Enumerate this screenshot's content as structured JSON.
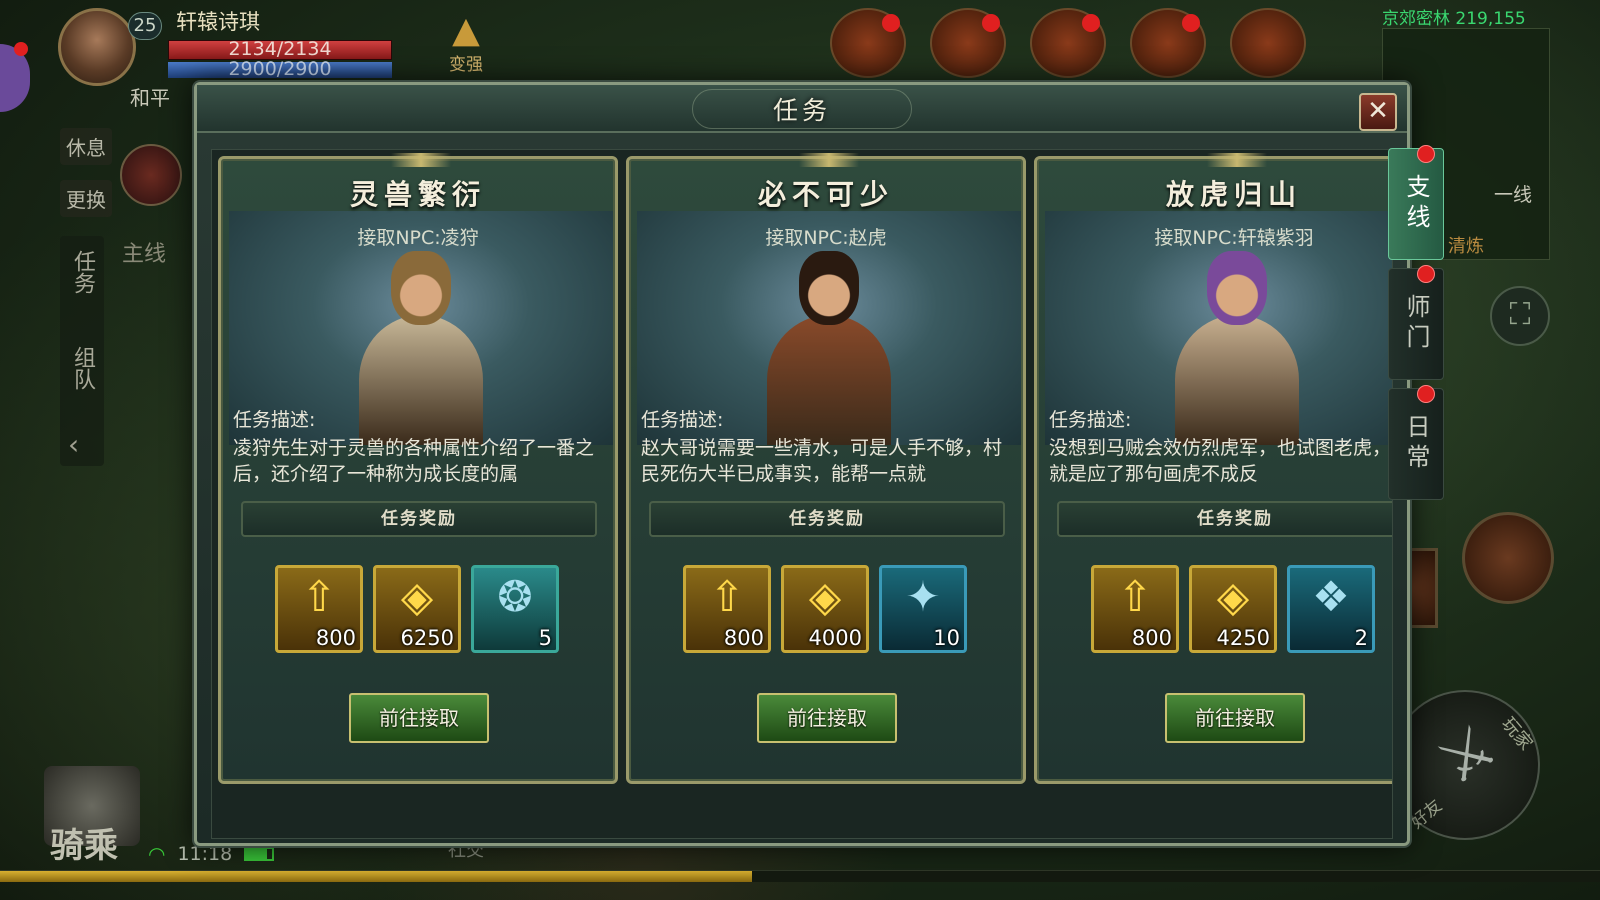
{
  "hud": {
    "player_name": "轩辕诗琪",
    "level": "25",
    "hp_text": "2134/2134",
    "mp_text": "2900/2900",
    "hp_ratio": 1.0,
    "mp_ratio": 1.0,
    "power_up_label": "变强",
    "mode": "和平",
    "rest_label": "休息",
    "swap_label": "更换",
    "main_quest_label": "主线",
    "left_tabs": [
      "任务",
      "组队"
    ],
    "location": "京郊密林 219,155",
    "line_label": "一线",
    "practice_label": "清炼",
    "mount_label": "骑乘",
    "clock": "11:18",
    "social_label": "社交",
    "play_label": "玩家",
    "friend_label": "好友",
    "exp_ratio": 0.47
  },
  "modal": {
    "title": "任务",
    "close_label": "✕",
    "side_tabs": [
      {
        "label": "支线",
        "active": true
      },
      {
        "label": "师门",
        "active": false
      },
      {
        "label": "日常",
        "active": false
      }
    ],
    "desc_label": "任务描述:",
    "reward_header": "任务奖励",
    "cards": [
      {
        "title": "灵兽繁衍",
        "npc": "接取NPC:凌狩",
        "desc": "凌狩先生对于灵兽的各种属性介绍了一番之后，还介绍了一种称为成长度的属",
        "hair": "#8a6a3a",
        "robe": "#c8b898",
        "rewards": [
          {
            "icon": "exp-icon",
            "glyph": "⇧",
            "qty": "800",
            "style": "gold"
          },
          {
            "icon": "gold-ingot-icon",
            "glyph": "◈",
            "qty": "6250",
            "style": "gold"
          },
          {
            "icon": "pet-orb-icon",
            "glyph": "❂",
            "qty": "5",
            "style": "teal"
          }
        ],
        "accept": "前往接取"
      },
      {
        "title": "必不可少",
        "npc": "接取NPC:赵虎",
        "desc": "赵大哥说需要一些清水，可是人手不够，村民死伤大半已成事实，能帮一点就",
        "hair": "#2a1a10",
        "robe": "#8a4a2a",
        "rewards": [
          {
            "icon": "exp-icon",
            "glyph": "⇧",
            "qty": "800",
            "style": "gold"
          },
          {
            "icon": "gold-ingot-icon",
            "glyph": "◈",
            "qty": "4000",
            "style": "gold"
          },
          {
            "icon": "rune-stone-icon",
            "glyph": "✦",
            "qty": "10",
            "style": "blue"
          }
        ],
        "accept": "前往接取"
      },
      {
        "title": "放虎归山",
        "npc": "接取NPC:轩辕紫羽",
        "desc": "没想到马贼会效仿烈虎军，也试图老虎，可就是应了那句画虎不成反",
        "hair": "#7a4a9a",
        "robe": "#c8b090",
        "rewards": [
          {
            "icon": "exp-icon",
            "glyph": "⇧",
            "qty": "800",
            "style": "gold"
          },
          {
            "icon": "gold-ingot-icon",
            "glyph": "◈",
            "qty": "4250",
            "style": "gold"
          },
          {
            "icon": "loot-bag-icon",
            "glyph": "❖",
            "qty": "2",
            "style": "blue"
          }
        ],
        "accept": "前往接取"
      }
    ]
  }
}
